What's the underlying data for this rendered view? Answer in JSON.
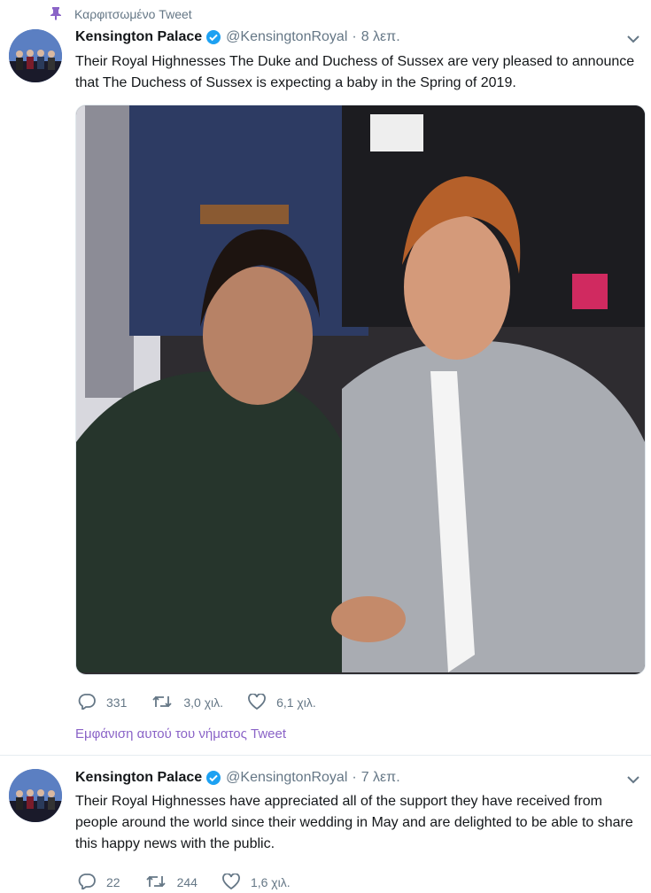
{
  "pinned_label": "Καρφιτσωμένο Tweet",
  "tweets": [
    {
      "name": "Kensington Palace",
      "handle": "@KensingtonRoyal",
      "separator": "·",
      "time": "8 λεπ.",
      "text": "Their Royal Highnesses The Duke and Duchess of Sussex are very pleased to announce that The Duchess of Sussex is expecting a baby in the Spring of 2019.",
      "replies": "331",
      "retweets": "3,0 χιλ.",
      "likes": "6,1 χιλ.",
      "thread_link": "Εμφάνιση αυτού του νήματος Tweet"
    },
    {
      "name": "Kensington Palace",
      "handle": "@KensingtonRoyal",
      "separator": "·",
      "time": "7 λεπ.",
      "text": "Their Royal Highnesses have appreciated all of the support they have received from people around the world since their wedding in May and are delighted to be able to share this happy news with the public.",
      "replies": "22",
      "retweets": "244",
      "likes": "1,6 χιλ."
    }
  ],
  "colors": {
    "accent": "#1da1f2",
    "pin": "#8a63c7",
    "link": "#8a63c7",
    "muted": "#657786"
  },
  "icons": [
    "pin-icon",
    "verified-icon",
    "chevron-down-icon",
    "reply-icon",
    "retweet-icon",
    "like-icon"
  ]
}
